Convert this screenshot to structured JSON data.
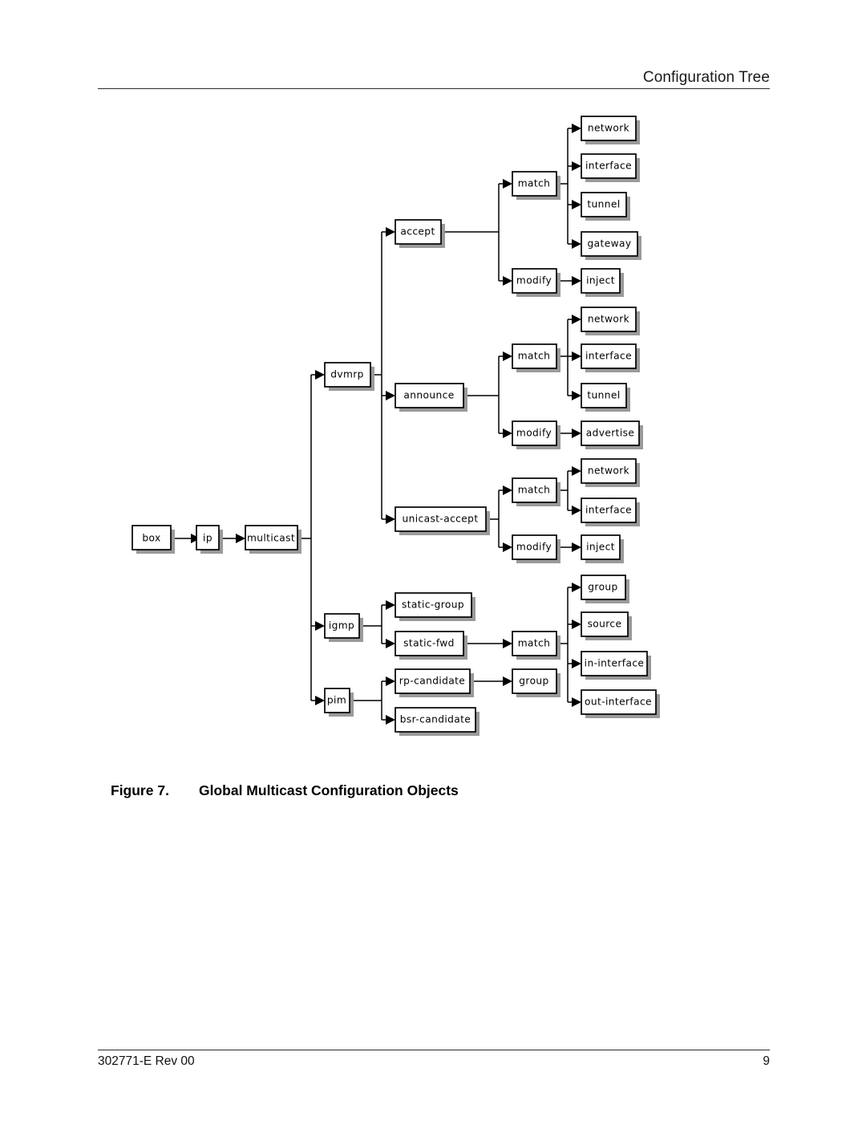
{
  "header": {
    "title": "Configuration Tree"
  },
  "caption": {
    "number": "Figure 7.",
    "title": "Global Multicast Configuration Objects"
  },
  "footer": {
    "document_id": "302771-E Rev 00",
    "page_number": "9"
  },
  "diagram": {
    "title": "Global Multicast Configuration Objects",
    "type": "tree",
    "root": "box",
    "nodes": {
      "box": "box",
      "ip": "ip",
      "multicast": "multicast",
      "dvmrp": "dvmrp",
      "igmp": "igmp",
      "pim": "pim",
      "accept": "accept",
      "announce": "announce",
      "unicast_accept": "unicast-accept",
      "accept_match": "match",
      "accept_modify": "modify",
      "accept_match_network": "network",
      "accept_match_interface": "interface",
      "accept_match_tunnel": "tunnel",
      "accept_match_gateway": "gateway",
      "accept_modify_inject": "inject",
      "announce_match": "match",
      "announce_modify": "modify",
      "announce_match_network": "network",
      "announce_match_interface": "interface",
      "announce_match_tunnel": "tunnel",
      "announce_modify_advertise": "advertise",
      "ua_match": "match",
      "ua_modify": "modify",
      "ua_match_network": "network",
      "ua_match_interface": "interface",
      "ua_modify_inject": "inject",
      "static_group": "static-group",
      "static_fwd": "static-fwd",
      "fwd_match": "match",
      "fwd_match_group": "group",
      "fwd_match_source": "source",
      "fwd_match_in_interface": "in-interface",
      "fwd_match_out_interface": "out-interface",
      "rp_candidate": "rp-candidate",
      "rp_group": "group",
      "bsr_candidate": "bsr-candidate"
    },
    "edges": [
      [
        "box",
        "ip"
      ],
      [
        "ip",
        "multicast"
      ],
      [
        "multicast",
        "dvmrp"
      ],
      [
        "multicast",
        "igmp"
      ],
      [
        "multicast",
        "pim"
      ],
      [
        "dvmrp",
        "accept"
      ],
      [
        "dvmrp",
        "announce"
      ],
      [
        "dvmrp",
        "unicast_accept"
      ],
      [
        "accept",
        "accept_match"
      ],
      [
        "accept",
        "accept_modify"
      ],
      [
        "accept_match",
        "accept_match_network"
      ],
      [
        "accept_match",
        "accept_match_interface"
      ],
      [
        "accept_match",
        "accept_match_tunnel"
      ],
      [
        "accept_match",
        "accept_match_gateway"
      ],
      [
        "accept_modify",
        "accept_modify_inject"
      ],
      [
        "announce",
        "announce_match"
      ],
      [
        "announce",
        "announce_modify"
      ],
      [
        "announce_match",
        "announce_match_network"
      ],
      [
        "announce_match",
        "announce_match_interface"
      ],
      [
        "announce_match",
        "announce_match_tunnel"
      ],
      [
        "announce_modify",
        "announce_modify_advertise"
      ],
      [
        "unicast_accept",
        "ua_match"
      ],
      [
        "unicast_accept",
        "ua_modify"
      ],
      [
        "ua_match",
        "ua_match_network"
      ],
      [
        "ua_match",
        "ua_match_interface"
      ],
      [
        "ua_modify",
        "ua_modify_inject"
      ],
      [
        "igmp",
        "static_group"
      ],
      [
        "igmp",
        "static_fwd"
      ],
      [
        "static_fwd",
        "fwd_match"
      ],
      [
        "fwd_match",
        "fwd_match_group"
      ],
      [
        "fwd_match",
        "fwd_match_source"
      ],
      [
        "fwd_match",
        "fwd_match_in_interface"
      ],
      [
        "fwd_match",
        "fwd_match_out_interface"
      ],
      [
        "pim",
        "rp_candidate"
      ],
      [
        "pim",
        "bsr_candidate"
      ],
      [
        "rp_candidate",
        "rp_group"
      ]
    ]
  }
}
